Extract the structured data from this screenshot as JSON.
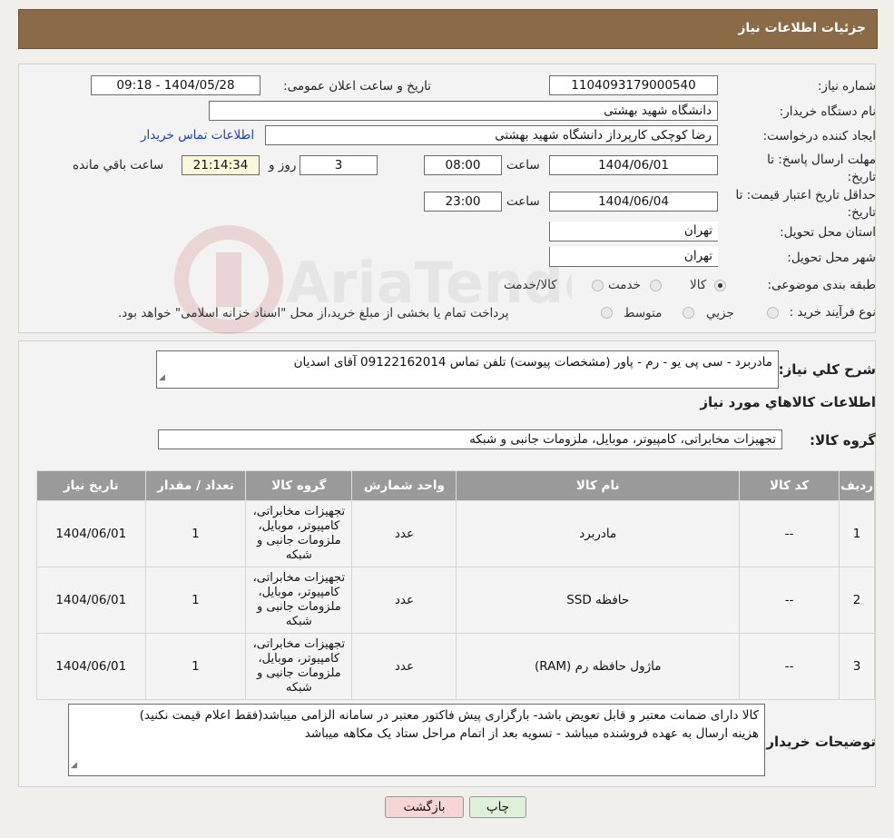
{
  "header": {
    "title": "جزئیات اطلاعات نیاز"
  },
  "details": {
    "need_number_label": "شماره نیاز:",
    "need_number": "1104093179000540",
    "announce_label": "تاریخ و ساعت اعلان عمومی:",
    "announce_value": "1404/05/28 - 09:18",
    "buyer_label": "نام دستگاه خریدار:",
    "buyer_value": "دانشگاه شهید بهشتی",
    "creator_label": "ایجاد کننده درخواست:",
    "creator_value": "رضا کوچکی کارپرداز دانشگاه شهید بهشتی",
    "contact_link": "اطلاعات تماس خریدار",
    "deadline_label": "مهلت ارسال پاسخ: تا تاریخ:",
    "deadline_date": "1404/06/01",
    "time_label": "ساعت",
    "deadline_time": "08:00",
    "days_value": "3",
    "days_label": "روز و",
    "remaining_time": "21:14:34",
    "remaining_label": "ساعت باقي مانده",
    "validity_label": "حداقل تاریخ اعتبار قیمت: تا تاریخ:",
    "validity_date": "1404/06/04",
    "validity_time": "23:00",
    "province_label": "استان محل تحویل:",
    "province_value": "تهران",
    "city_label": "شهر محل تحویل:",
    "city_value": "تهران",
    "category_label": "طبقه بندی موضوعی:",
    "category_options": [
      "کالا",
      "خدمت",
      "کالا/خدمت"
    ],
    "category_selected": "کالا",
    "process_label": "نوع فرآیند خرید :",
    "process_options": [
      "جزیي",
      "متوسط"
    ],
    "process_note": "پرداخت تمام یا بخشی از مبلغ خرید،از محل \"اسناد خزانه اسلامی\" خواهد بود."
  },
  "summary": {
    "desc_label": "شرح کلي نياز:",
    "desc_value": "مادربرد - سی پی یو - رم  - پاور (مشخصات پیوست) تلفن تماس 09122162014 آقای اسدیان",
    "goods_info_title": "اطلاعات کالاهاي مورد نياز",
    "group_label": "گروه کالا:",
    "group_value": "تجهیزات مخابراتی، کامپیوتر، موبایل، ملزومات جانبی و شبکه"
  },
  "table": {
    "headers": [
      "ردیف",
      "کد کالا",
      "نام کالا",
      "واحد شمارش",
      "گروه کالا",
      "تعداد / مقدار",
      "تاریخ نیاز"
    ],
    "rows": [
      [
        "1",
        "--",
        "مادربرد",
        "عدد",
        "تجهیزات مخابراتی، کامپیوتر، موبایل، ملزومات جانبی و شبکه",
        "1",
        "1404/06/01"
      ],
      [
        "2",
        "--",
        "حافظه SSD",
        "عدد",
        "تجهیزات مخابراتی، کامپیوتر، موبایل، ملزومات جانبی و شبکه",
        "1",
        "1404/06/01"
      ],
      [
        "3",
        "--",
        "ماژول حافظه رم (RAM)",
        "عدد",
        "تجهیزات مخابراتی، کامپیوتر، موبایل، ملزومات جانبی و شبکه",
        "1",
        "1404/06/01"
      ]
    ]
  },
  "notes": {
    "label": "توضیحات خریدار:",
    "line1": "کالا دارای ضمانت معتبر و قابل تعویض باشد- بارگزاری پیش فاکتور معتبر در سامانه الزامی میباشد(فقط اعلام قیمت نکنید)",
    "line2": "هزینه ارسال به عهده فروشنده میباشد - تسویه بعد از اتمام مراحل ستاد یک مکاهه میباشد"
  },
  "buttons": {
    "print": "چاپ",
    "back": "بازگشت"
  },
  "watermark_text": "AriaTender.neT",
  "colors": {
    "header_bg": "#8b6b45",
    "link": "#1a3fb3",
    "table_header": "#9a9a9a",
    "print_btn": "#dff0d8",
    "back_btn": "#f6d5d5"
  }
}
